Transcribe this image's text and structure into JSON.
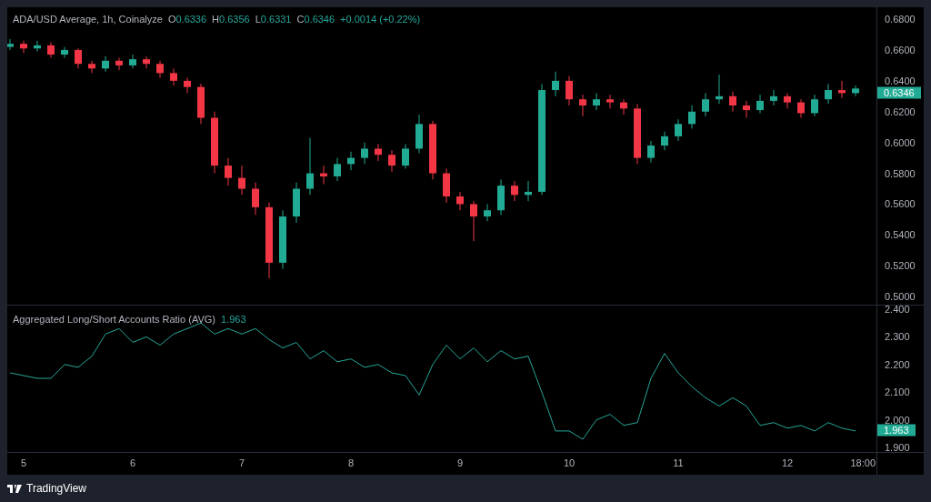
{
  "legend": {
    "title": "ADA/USD Average, 1h, Coinalyze",
    "ohlc": [
      {
        "label": "O",
        "value": "0.6336"
      },
      {
        "label": "H",
        "value": "0.6356"
      },
      {
        "label": "L",
        "value": "0.6331"
      },
      {
        "label": "C",
        "value": "0.6346"
      }
    ],
    "change": "+0.0014 (+0.22%)"
  },
  "price_chart": {
    "current_price": "0.6346",
    "chart_data": {
      "type": "candlestick",
      "x": [
        4.875,
        5,
        5.125,
        5.25,
        5.375,
        5.5,
        5.625,
        5.75,
        5.875,
        6,
        6.125,
        6.25,
        6.375,
        6.5,
        6.625,
        6.75,
        6.875,
        7,
        7.125,
        7.25,
        7.375,
        7.5,
        7.625,
        7.75,
        7.875,
        8,
        8.125,
        8.25,
        8.375,
        8.5,
        8.625,
        8.75,
        8.875,
        9,
        9.125,
        9.25,
        9.375,
        9.5,
        9.625,
        9.75,
        9.875,
        10,
        10.125,
        10.25,
        10.375,
        10.5,
        10.625,
        10.75,
        10.875,
        11,
        11.125,
        11.25,
        11.375,
        11.5,
        11.625,
        11.75,
        11.875,
        12,
        12.125,
        12.25,
        12.375,
        12.5,
        12.625
      ],
      "ohlc": [
        [
          0.662,
          0.667,
          0.66,
          0.664
        ],
        [
          0.664,
          0.666,
          0.658,
          0.661
        ],
        [
          0.661,
          0.666,
          0.659,
          0.663
        ],
        [
          0.663,
          0.665,
          0.655,
          0.657
        ],
        [
          0.657,
          0.662,
          0.655,
          0.66
        ],
        [
          0.66,
          0.661,
          0.648,
          0.651
        ],
        [
          0.651,
          0.653,
          0.645,
          0.648
        ],
        [
          0.648,
          0.656,
          0.646,
          0.653
        ],
        [
          0.653,
          0.655,
          0.647,
          0.65
        ],
        [
          0.65,
          0.657,
          0.648,
          0.654
        ],
        [
          0.654,
          0.656,
          0.648,
          0.651
        ],
        [
          0.651,
          0.653,
          0.642,
          0.645
        ],
        [
          0.645,
          0.648,
          0.637,
          0.64
        ],
        [
          0.64,
          0.642,
          0.632,
          0.636
        ],
        [
          0.636,
          0.638,
          0.612,
          0.616
        ],
        [
          0.616,
          0.62,
          0.58,
          0.585
        ],
        [
          0.585,
          0.59,
          0.572,
          0.577
        ],
        [
          0.577,
          0.585,
          0.566,
          0.57
        ],
        [
          0.57,
          0.574,
          0.553,
          0.558
        ],
        [
          0.558,
          0.561,
          0.512,
          0.522
        ],
        [
          0.522,
          0.556,
          0.518,
          0.552
        ],
        [
          0.552,
          0.574,
          0.548,
          0.57
        ],
        [
          0.57,
          0.603,
          0.566,
          0.58
        ],
        [
          0.58,
          0.585,
          0.573,
          0.578
        ],
        [
          0.578,
          0.59,
          0.575,
          0.586
        ],
        [
          0.586,
          0.594,
          0.582,
          0.59
        ],
        [
          0.59,
          0.6,
          0.586,
          0.596
        ],
        [
          0.596,
          0.599,
          0.588,
          0.592
        ],
        [
          0.592,
          0.595,
          0.581,
          0.585
        ],
        [
          0.585,
          0.599,
          0.583,
          0.596
        ],
        [
          0.596,
          0.618,
          0.593,
          0.612
        ],
        [
          0.612,
          0.614,
          0.576,
          0.58
        ],
        [
          0.58,
          0.583,
          0.561,
          0.565
        ],
        [
          0.565,
          0.568,
          0.556,
          0.56
        ],
        [
          0.56,
          0.562,
          0.536,
          0.552
        ],
        [
          0.552,
          0.56,
          0.549,
          0.556
        ],
        [
          0.556,
          0.576,
          0.553,
          0.572
        ],
        [
          0.572,
          0.575,
          0.562,
          0.566
        ],
        [
          0.566,
          0.575,
          0.562,
          0.568
        ],
        [
          0.568,
          0.638,
          0.566,
          0.634
        ],
        [
          0.634,
          0.646,
          0.63,
          0.64
        ],
        [
          0.64,
          0.643,
          0.624,
          0.628
        ],
        [
          0.628,
          0.631,
          0.617,
          0.624
        ],
        [
          0.624,
          0.632,
          0.621,
          0.628
        ],
        [
          0.628,
          0.631,
          0.622,
          0.626
        ],
        [
          0.626,
          0.628,
          0.618,
          0.622
        ],
        [
          0.622,
          0.625,
          0.586,
          0.59
        ],
        [
          0.59,
          0.601,
          0.587,
          0.598
        ],
        [
          0.598,
          0.607,
          0.595,
          0.604
        ],
        [
          0.604,
          0.615,
          0.601,
          0.612
        ],
        [
          0.612,
          0.624,
          0.609,
          0.62
        ],
        [
          0.62,
          0.632,
          0.617,
          0.628
        ],
        [
          0.628,
          0.644,
          0.625,
          0.63
        ],
        [
          0.63,
          0.633,
          0.62,
          0.624
        ],
        [
          0.624,
          0.627,
          0.616,
          0.621
        ],
        [
          0.621,
          0.631,
          0.619,
          0.627
        ],
        [
          0.627,
          0.634,
          0.624,
          0.63
        ],
        [
          0.63,
          0.632,
          0.622,
          0.626
        ],
        [
          0.626,
          0.628,
          0.616,
          0.619
        ],
        [
          0.619,
          0.631,
          0.617,
          0.628
        ],
        [
          0.628,
          0.638,
          0.625,
          0.634
        ],
        [
          0.634,
          0.64,
          0.629,
          0.632
        ],
        [
          0.632,
          0.637,
          0.63,
          0.635
        ]
      ],
      "xlim": [
        4.85,
        13.25
      ],
      "ylim": [
        0.4948,
        0.6877
      ],
      "yticks": [
        {
          "value": 0.68,
          "label": "0.6800"
        },
        {
          "value": 0.66,
          "label": "0.6600"
        },
        {
          "value": 0.64,
          "label": "0.6400"
        },
        {
          "value": 0.62,
          "label": "0.6200"
        },
        {
          "value": 0.6,
          "label": "0.6000"
        },
        {
          "value": 0.58,
          "label": "0.5800"
        },
        {
          "value": 0.56,
          "label": "0.5600"
        },
        {
          "value": 0.54,
          "label": "0.5400"
        },
        {
          "value": 0.52,
          "label": "0.5200"
        },
        {
          "value": 0.5,
          "label": "0.5000"
        }
      ]
    }
  },
  "indicator": {
    "value": "1.963",
    "current_value": "1.963",
    "chart_data": {
      "type": "line",
      "x": [
        4.875,
        5,
        5.125,
        5.25,
        5.375,
        5.5,
        5.625,
        5.75,
        5.875,
        6,
        6.125,
        6.25,
        6.375,
        6.5,
        6.625,
        6.75,
        6.875,
        7,
        7.125,
        7.25,
        7.375,
        7.5,
        7.625,
        7.75,
        7.875,
        8,
        8.125,
        8.25,
        8.375,
        8.5,
        8.625,
        8.75,
        8.875,
        9,
        9.125,
        9.25,
        9.375,
        9.5,
        9.625,
        9.75,
        9.875,
        10,
        10.125,
        10.25,
        10.375,
        10.5,
        10.625,
        10.75,
        10.875,
        11,
        11.125,
        11.25,
        11.375,
        11.5,
        11.625,
        11.75,
        11.875,
        12,
        12.125,
        12.25,
        12.375,
        12.5,
        12.625
      ],
      "series": [
        {
          "name": "Aggregated Long/Short Accounts Ratio (AVG)",
          "color": "#26a69a",
          "values": [
            2.17,
            2.16,
            2.15,
            2.15,
            2.2,
            2.19,
            2.23,
            2.31,
            2.33,
            2.28,
            2.3,
            2.27,
            2.31,
            2.33,
            2.35,
            2.31,
            2.33,
            2.31,
            2.33,
            2.29,
            2.26,
            2.28,
            2.22,
            2.25,
            2.21,
            2.22,
            2.19,
            2.2,
            2.17,
            2.16,
            2.09,
            2.2,
            2.27,
            2.22,
            2.26,
            2.21,
            2.25,
            2.22,
            2.23,
            2.1,
            1.96,
            1.96,
            1.93,
            2.0,
            2.02,
            1.98,
            1.99,
            2.15,
            2.24,
            2.17,
            2.12,
            2.08,
            2.05,
            2.08,
            2.05,
            1.98,
            1.99,
            1.97,
            1.98,
            1.96,
            1.99,
            1.97,
            1.96
          ]
        }
      ],
      "xlim": [
        4.85,
        13.25
      ],
      "ylim": [
        1.884,
        2.413
      ],
      "xticks": [
        5,
        6,
        7,
        8,
        9,
        10,
        11,
        12
      ],
      "yticks": [
        {
          "value": 2.4,
          "label": "2.400"
        },
        {
          "value": 2.3,
          "label": "2.300"
        },
        {
          "value": 2.2,
          "label": "2.200"
        },
        {
          "value": 2.1,
          "label": "2.100"
        },
        {
          "value": 2.0,
          "label": "2.000"
        },
        {
          "value": 1.9,
          "label": "1.900"
        }
      ]
    }
  },
  "time_marker": "18:00",
  "footer": {
    "brand": "TradingView"
  }
}
